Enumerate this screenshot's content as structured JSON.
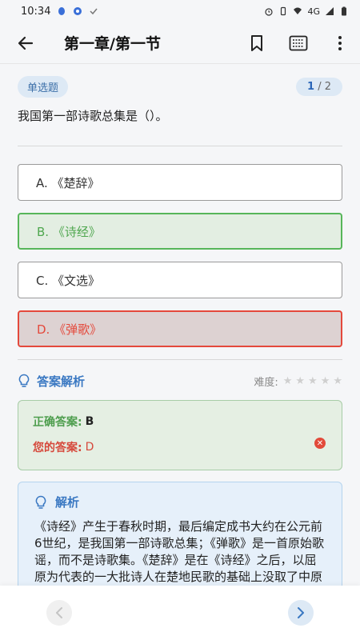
{
  "status_bar": {
    "time": "10:34",
    "network": "4G"
  },
  "header": {
    "title": "第一章/第一节"
  },
  "question": {
    "type": "单选题",
    "current": "1",
    "separator": " / ",
    "total": "2",
    "text": "我国第一部诗歌总集是（）。"
  },
  "options": [
    {
      "label": "A. 《楚辞》",
      "state": "normal"
    },
    {
      "label": "B. 《诗经》",
      "state": "correct"
    },
    {
      "label": "C. 《文选》",
      "state": "normal"
    },
    {
      "label": "D. 《弹歌》",
      "state": "wrong"
    }
  ],
  "analysis": {
    "title": "答案解析",
    "difficulty_label": "难度:",
    "difficulty_stars": 0,
    "difficulty_max": 5,
    "correct_label": "正确答案:",
    "correct_value": "B",
    "your_label": "您的答案:",
    "your_value": "D"
  },
  "explanation": {
    "title": "解析",
    "text": "《诗经》产生于春秋时期，最后编定成书大约在公元前6世纪，是我国第一部诗歌总集；《弹歌》是一首原始歌谣，而不是诗歌集。《楚辞》是在《诗经》之后，以屈原为代表的一大批诗人在楚地民歌的基础上没取了中原文化而"
  },
  "colors": {
    "accent": "#3a78c2",
    "correct": "#57b65a",
    "wrong": "#e4493c"
  }
}
